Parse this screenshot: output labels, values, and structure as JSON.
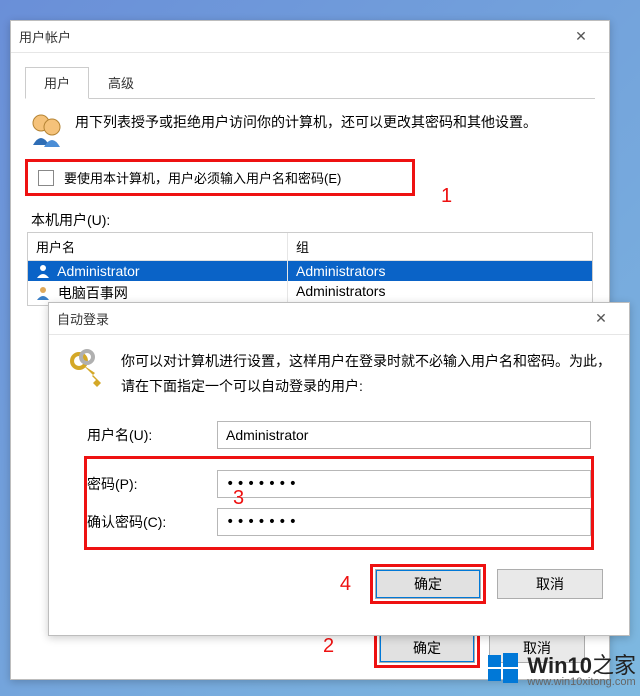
{
  "main": {
    "title": "用户帐户",
    "tabs": {
      "users": "用户",
      "advanced": "高级"
    },
    "desc": "用下列表授予或拒绝用户访问你的计算机，还可以更改其密码和其他设置。",
    "checkbox_label": "要使用本计算机，用户必须输入用户名和密码(E)",
    "users_label": "本机用户(U):",
    "col_user": "用户名",
    "col_group": "组",
    "rows": [
      {
        "user": "Administrator",
        "group": "Administrators",
        "selected": true
      },
      {
        "user": "电脑百事网",
        "group": "Administrators",
        "selected": false
      }
    ],
    "ok": "确定",
    "cancel": "取消"
  },
  "auto": {
    "title": "自动登录",
    "desc": "你可以对计算机进行设置，这样用户在登录时就不必输入用户名和密码。为此，请在下面指定一个可以自动登录的用户:",
    "username_label": "用户名(U):",
    "username_value": "Administrator",
    "password_label": "密码(P):",
    "confirm_label": "确认密码(C):",
    "password_mask": "•••••••",
    "ok": "确定",
    "cancel": "取消"
  },
  "annotations": {
    "a1": "1",
    "a2": "2",
    "a3": "3",
    "a4": "4"
  },
  "watermark": {
    "brand": "Win10",
    "suffix": "之家",
    "url": "www.win10xitong.com"
  }
}
